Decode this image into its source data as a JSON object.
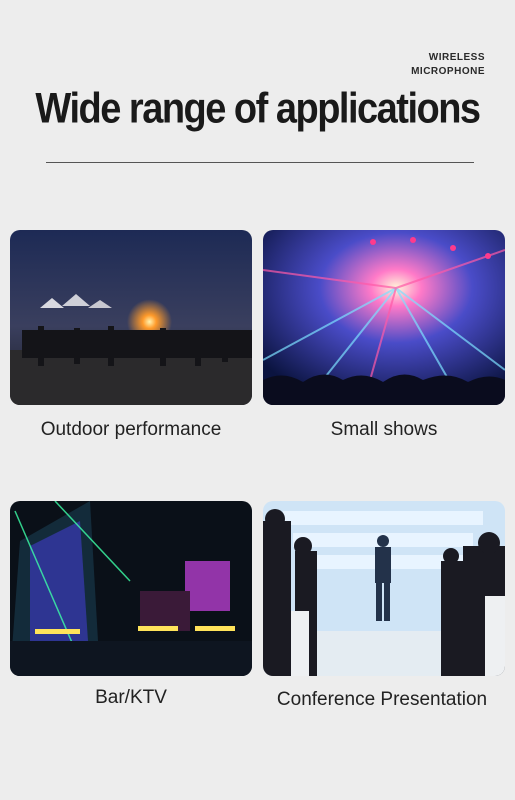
{
  "brand": {
    "line1": "WIRELESS",
    "line2": "MICROPHONE"
  },
  "headline": "Wide range of applications",
  "applications": [
    {
      "label": "Outdoor performance",
      "scene": "outdoor-night-crowd-bonfire"
    },
    {
      "label": "Small shows",
      "scene": "concert-stage-lights"
    },
    {
      "label": "Bar/KTV",
      "scene": "neon-bar-interior"
    },
    {
      "label": "Conference Presentation",
      "scene": "conference-speaker-audience"
    }
  ]
}
